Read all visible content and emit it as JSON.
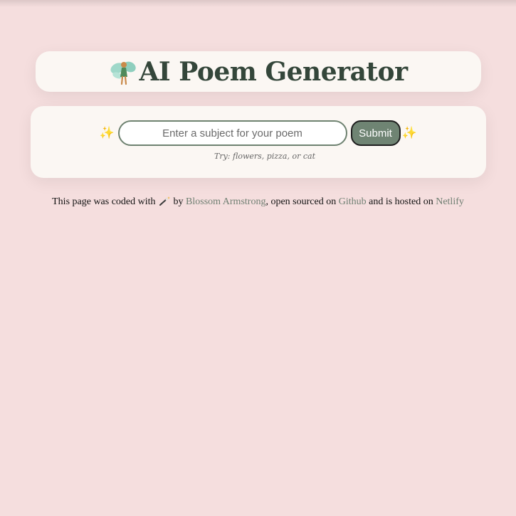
{
  "header": {
    "icon": "fairy-icon",
    "title": "AI Poem Generator"
  },
  "form": {
    "sparkle_left": "✨",
    "sparkle_right": "✨",
    "input_placeholder": "Enter a subject for your poem",
    "input_value": "",
    "submit_label": "Submit",
    "hint": "Try: flowers, pizza, or cat"
  },
  "footer": {
    "text_1": "This page was coded with",
    "wand_icon": "magic-wand-icon",
    "text_2": " by ",
    "author_link": "Blossom Armstrong",
    "text_3": ", open sourced on ",
    "github_link": "Github",
    "text_4": " and is hosted on ",
    "netlify_link": "Netlify"
  },
  "colors": {
    "background": "#f5dede",
    "card": "#fbf7f3",
    "title": "#34463a",
    "accent": "#6f8473",
    "link": "#6f7f72"
  }
}
